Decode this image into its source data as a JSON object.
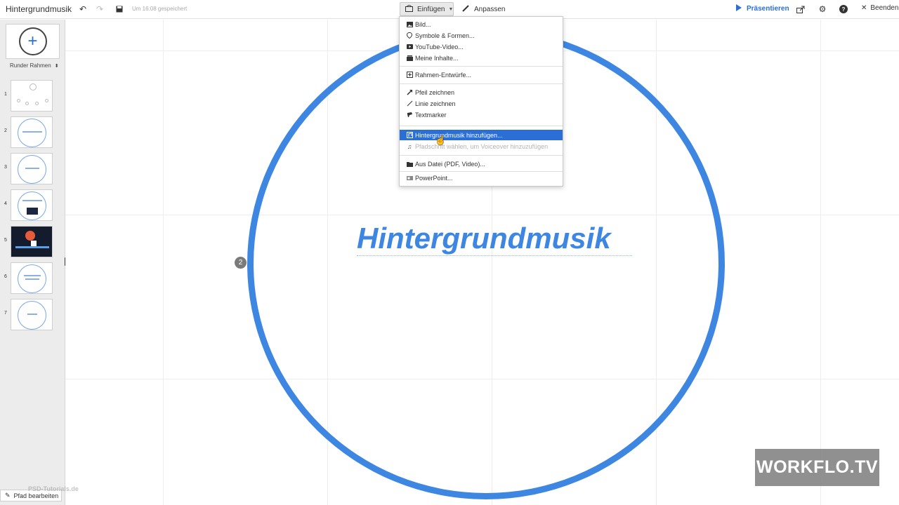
{
  "app": {
    "doc_title": "Hintergrundmusik",
    "saved_status": "Um 16:08 gespeichert"
  },
  "toolbar": {
    "insert_label": "Einfügen",
    "customize_label": "Anpassen",
    "present_label": "Präsentieren",
    "exit_label": "Beenden"
  },
  "sidebar": {
    "frame_type_label": "Runder Rahmen",
    "thumbnails": [
      "1",
      "2",
      "3",
      "4",
      "5",
      "6",
      "7"
    ],
    "edit_path_label": "Pfad bearbeiten"
  },
  "insert_menu": {
    "items": [
      {
        "label": "Bild...",
        "icon": "image-icon"
      },
      {
        "label": "Symbole & Formen...",
        "icon": "symbols-icon"
      },
      {
        "label": "YouTube-Video...",
        "icon": "youtube-icon"
      },
      {
        "label": "Meine Inhalte...",
        "icon": "my-content-icon"
      },
      {
        "label": "Rahmen-Entwürfe...",
        "icon": "frame-layouts-icon"
      },
      {
        "label": "Pfeil zeichnen",
        "icon": "arrow-icon"
      },
      {
        "label": "Linie zeichnen",
        "icon": "line-icon"
      },
      {
        "label": "Textmarker",
        "icon": "highlighter-icon"
      },
      {
        "label": "Hintergrundmusik hinzufügen...",
        "icon": "music-icon",
        "state": "highlighted"
      },
      {
        "label": "Pfadschritt wählen, um Voiceover hinzuzufügen",
        "icon": "note-icon",
        "state": "disabled"
      },
      {
        "label": "Aus Datei (PDF, Video)...",
        "icon": "folder-icon"
      },
      {
        "label": "PowerPoint...",
        "icon": "powerpoint-icon"
      }
    ]
  },
  "canvas": {
    "title": "Hintergrundmusik",
    "path_badge": "2"
  },
  "watermarks": {
    "brand": "WORKFLO.TV",
    "site": "PSD-Tutorials.de"
  },
  "colors": {
    "accent": "#3d87e2",
    "menu_highlight": "#2a6fd6"
  }
}
